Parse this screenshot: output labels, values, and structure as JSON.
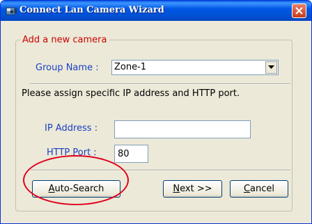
{
  "window": {
    "title": "Connect Lan Camera Wizard",
    "icons": {
      "app": "camera-app-icon",
      "close": "close-icon"
    }
  },
  "group": {
    "legend": "Add a new camera"
  },
  "group_name": {
    "label": "Group Name :",
    "value": "Zone-1",
    "arrow_icon": "dropdown-arrow-icon"
  },
  "instruction": "Please assign specific IP address and HTTP port.",
  "ip_address": {
    "label": "IP Address :",
    "value": ""
  },
  "http_port": {
    "label": "HTTP Port :",
    "value": "80"
  },
  "buttons": {
    "auto_search": {
      "mnemonic": "A",
      "rest": "uto-Search"
    },
    "next": {
      "mnemonic": "N",
      "rest": "ext >>"
    },
    "cancel": {
      "mnemonic": "C",
      "rest": "ancel"
    }
  },
  "colors": {
    "legend": "#cc0000",
    "label": "#1a3fc4",
    "highlight_ring": "#e0001a",
    "titlebar": "#0058e6"
  }
}
